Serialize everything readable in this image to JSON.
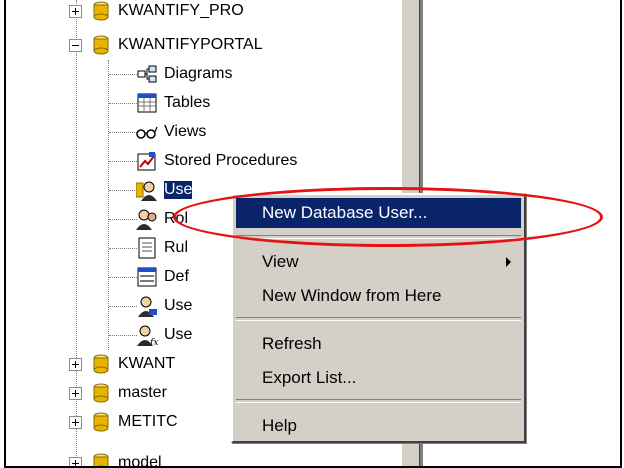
{
  "tree": {
    "items": [
      {
        "label": "KWANTIFY_PRO",
        "icon": "database-icon"
      },
      {
        "label": "KWANTIFYPORTAL",
        "icon": "database-icon"
      },
      {
        "label": "Diagrams",
        "icon": "diagram-icon"
      },
      {
        "label": "Tables",
        "icon": "table-icon"
      },
      {
        "label": "Views",
        "icon": "glasses-icon"
      },
      {
        "label": "Stored Procedures",
        "icon": "stored-procedure-icon"
      },
      {
        "label": "Use",
        "icon": "users-icon"
      },
      {
        "label": "Rol",
        "icon": "roles-icon"
      },
      {
        "label": "Rul",
        "icon": "rules-icon"
      },
      {
        "label": "Def",
        "icon": "defaults-icon"
      },
      {
        "label": "Use",
        "icon": "user-defined-types-icon"
      },
      {
        "label": "Use",
        "icon": "user-defined-functions-icon"
      },
      {
        "label": "KWANT",
        "icon": "database-icon"
      },
      {
        "label": "master",
        "icon": "database-icon"
      },
      {
        "label": "METITC",
        "icon": "database-icon"
      },
      {
        "label": "model",
        "icon": "database-icon"
      }
    ]
  },
  "context_menu": {
    "items": [
      {
        "label": "New Database User...",
        "selected": true
      },
      {
        "label": "View",
        "has_submenu": true
      },
      {
        "label": "New Window from Here"
      },
      {
        "label": "Refresh"
      },
      {
        "label": "Export List..."
      },
      {
        "label": "Help"
      }
    ]
  },
  "annotation": {
    "color": "#e31313"
  },
  "colors": {
    "selection": "#0a246a",
    "menu_bg": "#d4d0c8"
  }
}
